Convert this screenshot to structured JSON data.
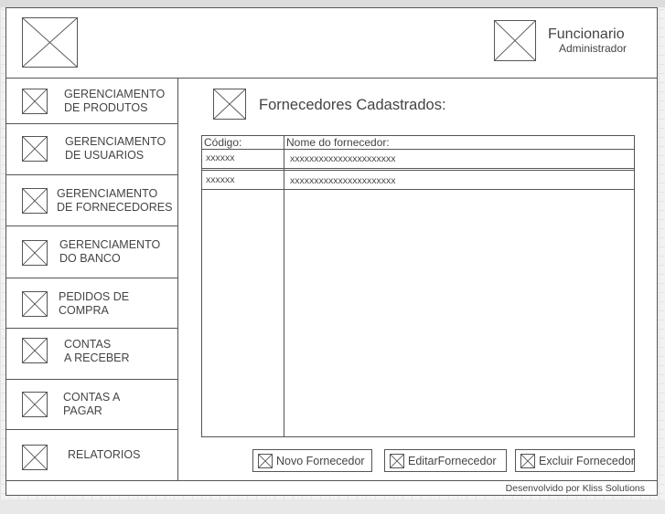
{
  "header": {
    "user_name": "Funcionario",
    "user_role": "Administrador"
  },
  "sidebar": {
    "items": [
      {
        "label": "GERENCIAMENTO\nDE PRODUTOS"
      },
      {
        "label": "GERENCIAMENTO\nDE USUARIOS"
      },
      {
        "label": "GERENCIAMENTO\nDE FORNECEDORES"
      },
      {
        "label": "GERENCIAMENTO\nDO BANCO"
      },
      {
        "label": "PEDIDOS DE\nCOMPRA"
      },
      {
        "label": "CONTAS\nA RECEBER"
      },
      {
        "label": "CONTAS A\nPAGAR"
      },
      {
        "label": "RELATORIOS"
      }
    ]
  },
  "main": {
    "title": "Fornecedores Cadastrados:",
    "table": {
      "columns": [
        "Código:",
        "Nome do fornecedor:"
      ],
      "rows": [
        [
          "xxxxxx",
          "xxxxxxxxxxxxxxxxxxxxxx"
        ],
        [
          "xxxxxx",
          "xxxxxxxxxxxxxxxxxxxxxx"
        ]
      ]
    },
    "buttons": {
      "new_label": "Novo Fornecedor",
      "edit_label": "EditarFornecedor",
      "delete_label": "Excluir Fornecedor"
    }
  },
  "footer": {
    "text": "Desenvolvido por Kliss Solutions"
  }
}
